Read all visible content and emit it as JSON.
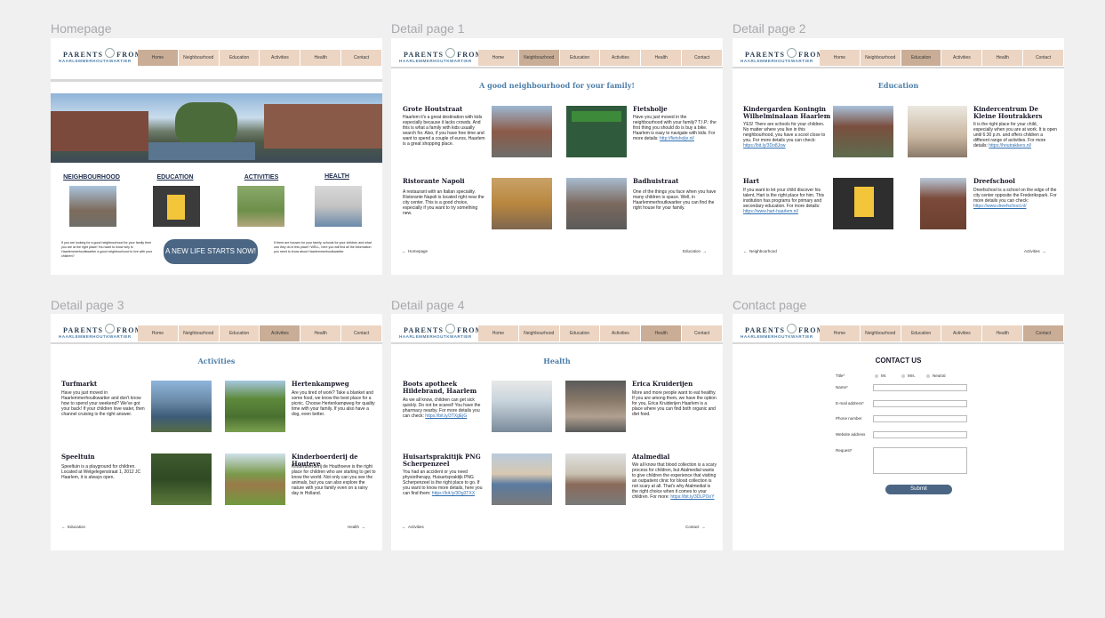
{
  "frames": {
    "home": "Homepage",
    "d1": "Detail page 1",
    "d2": "Detail page 2",
    "d3": "Detail page 3",
    "d4": "Detail page 4",
    "contact": "Contact page"
  },
  "logo": {
    "line1a": "PARENTS",
    "line1b": "FROM",
    "line2": "HAARLEMMERHOUTKWARTIER"
  },
  "nav": [
    "Home",
    "Neighbourhood",
    "Education",
    "Activities",
    "Health",
    "Contact"
  ],
  "home": {
    "cats": [
      "NEIGHBOURHOOD",
      "EDUCATION",
      "ACTIVITIES",
      "HEALTH"
    ],
    "left_text": "If you are looking for a good neighbourhood for your family then you are at the right place! You want to know why is Haarlemmerhoutkwartier a good neighbourhood to live with your children?",
    "cta": "A NEW LIFE STARTS NOW!",
    "right_text": "If there are houses for your family, schools for your children and what can they do in this place? WELL, here you will find all the information you need to know about Haarlemmerhoutkwartier."
  },
  "d1": {
    "title": "A good neighbourhood for your family!",
    "items": [
      {
        "name": "Grote Houtstraat",
        "text": "Haarlem it's a great destination with kids especially because it lacks crowds. And this is what a family with kids usually search for. Also, if you have free time and want to spend a couple of euros, Haarlem is a great shopping place."
      },
      {
        "name": "Fietsholje",
        "text": "Have you just moved in the neighbourhood with your family? T.I.P.: the first thing you should do is buy a bike. Haarlem is easy to navigate with kids. For more details: ",
        "link": "http://fietsholje.nl/"
      },
      {
        "name": "Ristorante Napoli",
        "text": "A restaurant with an Italian speciality. Ristorante Napoli is located right near the city center. This is a good choice, especially if you want to try something new."
      },
      {
        "name": "Badhuistraat",
        "text": "One of the things you face when you have many children is space. Well, in Haarlemmerhoutkwartier you can find the right house for your family."
      }
    ],
    "prev": "Homepage",
    "next": "Education"
  },
  "d2": {
    "title": "Education",
    "items": [
      {
        "name": "Kindergarden Koningin Wilhelminalaan Haarlem",
        "text": "YES! There are schools for your children. No matter where you live in this neighbourhood, you have a scool close to you. For more details you can check: ",
        "link": "https://bit.ly/3Do8Jow"
      },
      {
        "name": "Kindercentrum De Kleine Houtrakkers",
        "text": "It is the right place for your child, especially when you are at work. It is open until 6:30 p.m. and offers children a different range of activities. For more details: ",
        "link": "https://houtrakkers.nl/"
      },
      {
        "name": "Hart",
        "text": "If you want to let your child discover his talent, Hart is the right place for him. This institution has programs for primary and secondary education. For more details: ",
        "link": "https://www.hart-haarlem.nl/"
      },
      {
        "name": "Dreefschool",
        "text": "Dreefschool is a school on the edge of the city center opposite the Frederikspark. For more details you can check: ",
        "link": "https://www.dreefschool.nl/"
      }
    ],
    "prev": "Neighbourhood",
    "next": "Activities"
  },
  "d3": {
    "title": "Activities",
    "items": [
      {
        "name": "Turfmarkt",
        "text": "Have you just moved in Haarlemmerhoutkwartier and don't know how to spend your weekend? We've got your back! If your children love water, then channel cruising is the right answer."
      },
      {
        "name": "Hertenkampweg",
        "text": "Are you tired of work? Take a blanket and some food, we know the best place for a picnic. Choose Hertenkampweg for quality time with your family. If you also have a dog, even better."
      },
      {
        "name": "Speeltuin",
        "text": "Speeltuin is a playground for children. Located at Welgelegenstraat 1, 2012 JC Haarlem, it is always open."
      },
      {
        "name": "Kinderboerderij de Houteve",
        "text": "Kinderboerderij de Houthoeve is the right place for children who are starting to get to know the world. Not only can you see the animals, but you can also explore the nature with your family even on a rainy day in Holland."
      }
    ],
    "prev": "Education",
    "next": "Health"
  },
  "d4": {
    "title": "Health",
    "items": [
      {
        "name": "Boots apotheek Hildebrand, Haarlem",
        "text": "As we all know, children can get sick quickly. Do not be scared! You have the pharmacy nearby. For more details you can check: ",
        "link": "https://bit.ly/3TXgEjG"
      },
      {
        "name": "Erica Kruiderijen",
        "text": "More and more people want to eat healthy. If you are among them, we have the option for you, Erica Kruiderijen Haarlem is a place where you can find both organic and diet food."
      },
      {
        "name": "Huisartsprakitijk PNG Scherpenzeel",
        "text": "You had an accident or you need physiotherapy, Huisartspraktijk PNG Scherpenzeel is the right place to go. If you want to know more details, here you can find them: ",
        "link": "https://bit.ly/3Dg3TXX"
      },
      {
        "name": "Atalmedial",
        "text": "We all know that blood collection is a scary process for children, but Atalmedial wants to give children the experience that visiting an outpatient clinic for blood collection is not scary at all. That's why Atalmedial is the right choice when it comes to your children. For more: ",
        "link": "https://bit.ly/3DLPOoY"
      }
    ],
    "prev": "Activities",
    "next": "Contact"
  },
  "contact": {
    "title": "CONTACT US",
    "title_label": "Title*",
    "options": [
      "Mr.",
      "Mrs.",
      "Neutral"
    ],
    "fields": [
      "Name*",
      "E-mail address*",
      "Phone number",
      "Website address",
      "Request*"
    ],
    "submit": "Submit"
  },
  "colors": {
    "nav": "#ecd5c3",
    "nav_active": "#c9ad96",
    "accent": "#4d7ea8",
    "button": "#4a6684"
  }
}
